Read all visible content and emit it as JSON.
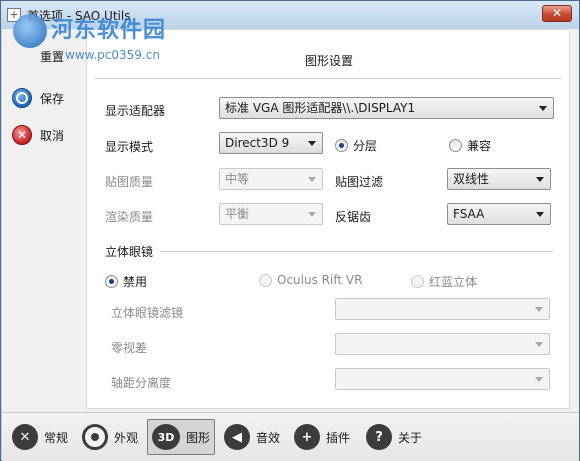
{
  "window": {
    "title": "首选项 - SAO Utils",
    "close_label": "✕"
  },
  "watermark": {
    "title": "河东软件园",
    "url": "www.pc0359.cn"
  },
  "sidebar": {
    "items": [
      {
        "label": "重置",
        "icon": "reset-icon"
      },
      {
        "label": "保存",
        "icon": "save-icon"
      },
      {
        "label": "取消",
        "icon": "cancel-icon"
      }
    ]
  },
  "panel": {
    "title": "图形设置",
    "adapter": {
      "label": "显示适配器",
      "value": "标准 VGA 图形适配器\\\\.\\DISPLAY1"
    },
    "display_mode": {
      "label": "显示模式",
      "value": "Direct3D 9",
      "opt_layered": "分层",
      "opt_compat": "兼容"
    },
    "texture_quality": {
      "label": "贴图质量",
      "value": "中等"
    },
    "texture_filter": {
      "label": "贴图过滤",
      "value": "双线性"
    },
    "render_quality": {
      "label": "渲染质量",
      "value": "平衡"
    },
    "antialias": {
      "label": "反锯齿",
      "value": "FSAA"
    },
    "stereo": {
      "group_label": "立体眼镜",
      "opt_disabled": "禁用",
      "opt_oculus": "Oculus Rift VR",
      "opt_anaglyph": "红蓝立体",
      "filter_label": "立体眼镜滤镜",
      "parallax_label": "零视差",
      "axis_label": "轴距分离度",
      "filter_value": "",
      "parallax_value": "",
      "axis_value": ""
    }
  },
  "toolbar": {
    "items": [
      {
        "label": "常规",
        "icon": "wrench-icon"
      },
      {
        "label": "外观",
        "icon": "eye-icon"
      },
      {
        "label": "图形",
        "icon": "3d-icon",
        "icon_text": "3D"
      },
      {
        "label": "音效",
        "icon": "speaker-icon"
      },
      {
        "label": "插件",
        "icon": "plus-icon"
      },
      {
        "label": "关于",
        "icon": "question-icon"
      }
    ],
    "active": "图形"
  }
}
